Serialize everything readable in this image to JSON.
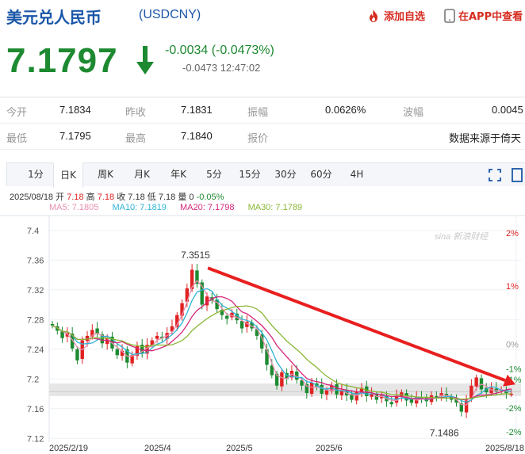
{
  "header": {
    "title": "美元兑人民币",
    "code": "(USDCNY)",
    "add_fav": "添加自选",
    "app_link": "在APP中查看"
  },
  "quote": {
    "price": "7.1797",
    "change": "-0.0034 (-0.0473%)",
    "sub": "-0.0473 12:47:02"
  },
  "stats": {
    "open_label": "今开",
    "open": "7.1834",
    "prev_label": "昨收",
    "prev": "7.1831",
    "amp_label": "振幅",
    "amp": "0.0626%",
    "wave_label": "波幅",
    "wave": "0.0045",
    "low_label": "最低",
    "low": "7.1795",
    "high_label": "最高",
    "high": "7.1840",
    "quote_label": "报价",
    "source": "数据来源于倚天"
  },
  "tabs": [
    "1分",
    "日K",
    "周K",
    "月K",
    "年K",
    "5分",
    "15分",
    "30分",
    "60分",
    "4H"
  ],
  "active_tab": "日K",
  "ohlc": {
    "date": "2025/08/18",
    "open_label": "开",
    "open": "7.18",
    "high_label": "高",
    "high": "7.18",
    "close_label": "收",
    "close": "7.18",
    "low_label": "低",
    "low": "7.18",
    "vol_label": "量",
    "vol": "0",
    "pct": "-0.05%"
  },
  "ma": {
    "ma5": "MA5: 7.1805",
    "ma10": "MA10: 7.1819",
    "ma20": "MA20: 7.1798",
    "ma30": "MA30: 7.1789"
  },
  "colors": {
    "up": "#e02222",
    "down": "#1d8a31",
    "brand": "#1a56a8",
    "ma5": "#e88fb0",
    "ma10": "#2fb4d6",
    "ma20": "#d6267a",
    "ma30": "#8ab634"
  },
  "chart_data": {
    "type": "candlestick",
    "ylim": [
      7.115,
      7.42
    ],
    "y_ticks": [
      "7.4",
      "7.36",
      "7.32",
      "7.28",
      "7.24",
      "7.2",
      "7.16",
      "7.12"
    ],
    "right_ticks": [
      "2%",
      "1%",
      "0%",
      "-1%",
      "-1%",
      "-2%",
      "-2%"
    ],
    "x_labels": [
      "2025/2/19",
      "2025/4",
      "2025/5",
      "2025/6",
      "2025/8/18"
    ],
    "annotations": [
      {
        "label": "7.3515",
        "value": 7.3515
      },
      {
        "label": "7.1486",
        "value": 7.1486
      }
    ],
    "watermark": "sina 新浪财经",
    "close_path": [
      7.272,
      7.265,
      7.255,
      7.262,
      7.241,
      7.225,
      7.252,
      7.258,
      7.266,
      7.261,
      7.248,
      7.255,
      7.241,
      7.232,
      7.238,
      7.222,
      7.232,
      7.244,
      7.235,
      7.246,
      7.252,
      7.258,
      7.255,
      7.262,
      7.271,
      7.286,
      7.302,
      7.322,
      7.347,
      7.328,
      7.3,
      7.311,
      7.305,
      7.294,
      7.286,
      7.281,
      7.289,
      7.279,
      7.268,
      7.277,
      7.268,
      7.258,
      7.241,
      7.219,
      7.205,
      7.191,
      7.209,
      7.2,
      7.211,
      7.199,
      7.191,
      7.181,
      7.195,
      7.19,
      7.18,
      7.185,
      7.191,
      7.179,
      7.186,
      7.178,
      7.172,
      7.183,
      7.188,
      7.177,
      7.18,
      7.172,
      7.178,
      7.17,
      7.166,
      7.177,
      7.182,
      7.171,
      7.168,
      7.176,
      7.174,
      7.17,
      7.178,
      7.175,
      7.181,
      7.177,
      7.172,
      7.168,
      7.156,
      7.171,
      7.191,
      7.202,
      7.186,
      7.182,
      7.188,
      7.183,
      7.186,
      7.181,
      7.18
    ]
  }
}
